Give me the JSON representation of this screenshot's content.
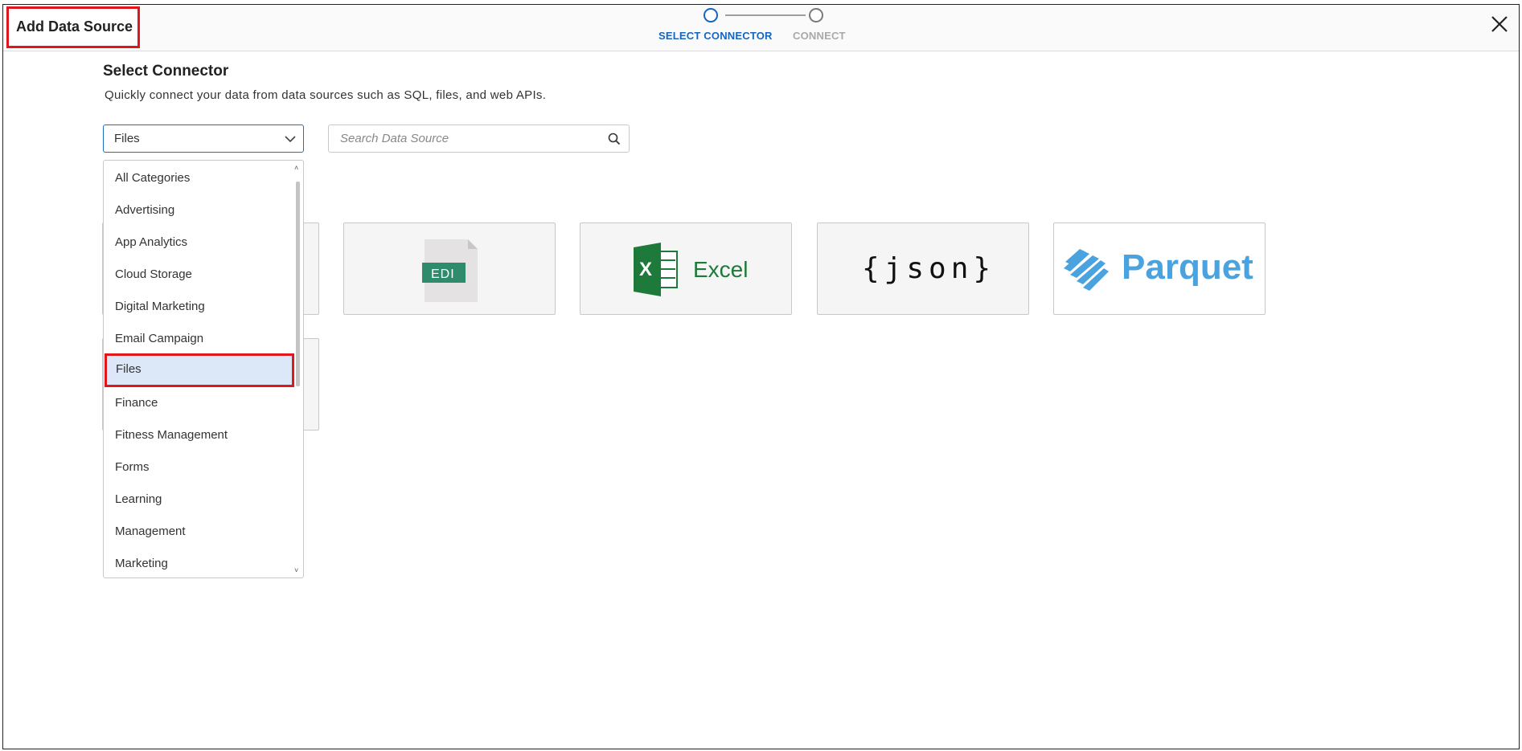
{
  "header": {
    "title": "Add Data Source",
    "steps": [
      {
        "label": "SELECT CONNECTOR",
        "state": "active"
      },
      {
        "label": "CONNECT",
        "state": "inactive"
      }
    ]
  },
  "main": {
    "title": "Select Connector",
    "subtitle": "Quickly connect your data from data sources such as SQL, files, and web APIs.",
    "category_select": {
      "value": "Files"
    },
    "search": {
      "placeholder": "Search Data Source",
      "value": ""
    },
    "dropdown": {
      "items": [
        "All Categories",
        "Advertising",
        "App Analytics",
        "Cloud Storage",
        "Digital Marketing",
        "Email Campaign",
        "Files",
        "Finance",
        "Fitness Management",
        "Forms",
        "Learning",
        "Management",
        "Marketing"
      ],
      "selected": "Files"
    },
    "connectors": [
      {
        "name": "EDI",
        "label": "EDI"
      },
      {
        "name": "Excel",
        "label": "Excel",
        "badge": "X"
      },
      {
        "name": "JSON",
        "label": "{json}"
      },
      {
        "name": "Parquet",
        "label": "Parquet"
      }
    ]
  },
  "colors": {
    "accent": "#1565c0",
    "highlight_border": "#e0161f",
    "selected_bg": "#dce8f8",
    "excel_green": "#1d7a3a",
    "edi_green": "#2e8b6b",
    "parquet_blue": "#4aa3df"
  },
  "icons": [
    "close-icon",
    "chevron-down-icon",
    "search-icon",
    "scroll-up-icon",
    "scroll-down-icon"
  ]
}
